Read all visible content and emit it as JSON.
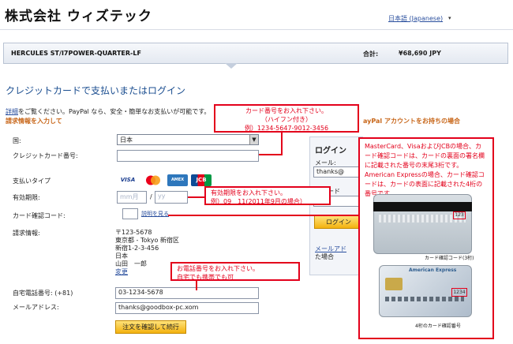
{
  "header": {
    "title": "株式会社 ウィズテック",
    "language": "日本語 (Japanese)",
    "language_arrow": "▾"
  },
  "order_bar": {
    "product": "HERCULES ST/I7POWER-QUARTER-LF",
    "total_label": "合計:",
    "total_value": "¥68,690  JPY"
  },
  "page": {
    "heading": "クレジットカードで支払いまたはログイン",
    "intro_link": "詳細",
    "intro_text": "をご覧ください。PayPal なら、安全・簡単なお支払いが可能です。",
    "sub_left": "請求情報を入力して",
    "sub_right": "ayPal アカウントをお持ちの場合"
  },
  "form": {
    "country_label": "国:",
    "country_value": "日本",
    "card_number_label": "クレジットカード番号:",
    "payment_type_label": "支払いタイプ",
    "card_types": [
      "VISA",
      "MC",
      "AMEX",
      "JCB"
    ],
    "expiry_label": "有効期限:",
    "expiry_month_placeholder": "mm",
    "expiry_month_unit": "月",
    "expiry_separator": "/",
    "expiry_year_placeholder": "yy",
    "cvv_label": "カード確認コード:",
    "cvv_help_link": "説明を見る",
    "billing_label": "請求情報:",
    "billing_address": [
      "〒123-5678",
      "東京都 - Tokyo 新宿区",
      "新宿1-2-3-456",
      "日本",
      "山田　一郎"
    ],
    "billing_change_link": "変更",
    "phone_label": "自宅電話番号: (+81)",
    "phone_value": "03-1234-5678",
    "email_label": "メールアドレス:",
    "email_value": "thanks@goodbox-pc.xom",
    "submit_label": "注文を確認して続行"
  },
  "login_panel": {
    "title": "ログイン",
    "email_label": "メール:",
    "email_value": "thanks@",
    "password_label": "スワード",
    "login_button": "ログイン",
    "link_text": "メールアド",
    "link_tail": "た場合"
  },
  "annotations": {
    "card_number_note": [
      "カード番号をお入れ下さい。",
      "（ハイフン付き）",
      "例）1234-5647-9012-3456"
    ],
    "expiry_note": [
      "有効期限をお入れ下さい。",
      "例）09　11(2011年9月の場合）"
    ],
    "phone_note": [
      "お電話番号をお入れ下さい。",
      "自宅でも携帯でも可"
    ],
    "cvv_note": "MasterCard、VisaおよびJCBの場合、カード確認コードは、カードの裏面の署名欄に記載された番号の末尾3桁です。American Expressの場合、カード確認コードは、カードの表面に記載された4桁の番号です",
    "card_back_caption": "カード確認コード(3桁)",
    "card_back_code": "123",
    "amex_name": "American Express",
    "amex_code": "1234",
    "amex_caption": "4桁のカード確認番号"
  },
  "colors": {
    "accent_blue": "#1b4e90",
    "annotation_red": "#e3001b",
    "button_yellow": "#f3b20f",
    "orange_text": "#c8671a"
  }
}
